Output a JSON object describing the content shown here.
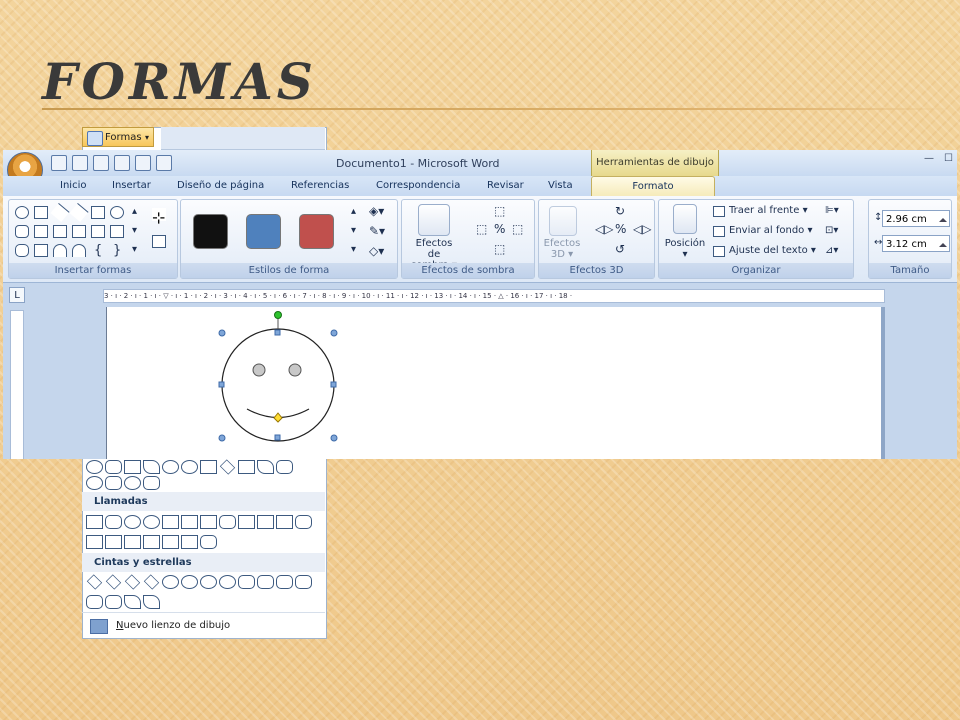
{
  "slide": {
    "title": "FORMAS"
  },
  "shapes_panel": {
    "formas_button": "Formas",
    "categories": [
      {
        "label": "Llamadas"
      },
      {
        "label": "Cintas y estrellas"
      }
    ],
    "new_canvas_prefix": "N",
    "new_canvas_rest": "uevo lienzo de dibujo"
  },
  "window": {
    "title": "Documento1 - Microsoft Word",
    "tools_context": "Herramientas de dibujo"
  },
  "tabs": [
    "Inicio",
    "Insertar",
    "Diseño de página",
    "Referencias",
    "Correspondencia",
    "Revisar",
    "Vista",
    "Formato"
  ],
  "active_tab": "Formato",
  "ribbon": {
    "groups": {
      "insert_shapes": "Insertar formas",
      "shape_styles": "Estilos de forma",
      "shadow_effects": "Efectos de sombra",
      "effects_3d": "Efectos 3D",
      "arrange": "Organizar",
      "size": "Tamaño"
    },
    "shadow_button_line1": "Efectos de",
    "shadow_button_line2": "sombra",
    "effects3d_line1": "Efectos",
    "effects3d_line2": "3D",
    "position": "Posición",
    "bring_front": "Traer al frente",
    "send_back": "Enviar al fondo",
    "text_wrap": "Ajuste del texto",
    "height": "2.96 cm",
    "width": "3.12 cm",
    "style_colors": [
      "#111111",
      "#4f81bd",
      "#c0504d"
    ]
  },
  "ruler": {
    "corner": "L",
    "ticks": "3 · ı · 2 · ı · 1 · ı · ▽ · ı · 1 · ı · 2 · ı · 3 · ı · 4 · ı · 5 · ı · 6 · ı · 7 · ı · 8 · ı · 9 · ı · 10 · ı · 11 · ı · 12 · ı · 13 · ı · 14 · ı · 15 · △ · 16 · ı · 17 · ı · 18 ·"
  }
}
